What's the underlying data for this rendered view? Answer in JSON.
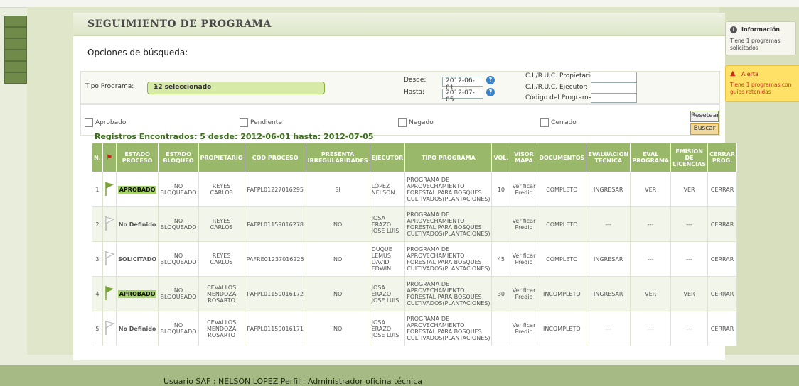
{
  "page": {
    "title": "SEGUIMIENTO DE PROGRAMA",
    "search_options_label": "Opciones de búsqueda:"
  },
  "search": {
    "tipo_programa_label": "Tipo Programa:",
    "tipo_programa_value": "12 seleccionado",
    "desde_label": "Desde:",
    "desde_value": "2012-06-01",
    "hasta_label": "Hasta:",
    "hasta_value": "2012-07-05",
    "ruc_propietario_label": "C.I./R.U.C. Propietario:",
    "ruc_ejecutor_label": "C.I./R.U.C. Ejecutor:",
    "codigo_programa_label": "Código del Programa:",
    "status_filters": [
      "Aprobado",
      "Pendiente",
      "Negado",
      "Cerrado"
    ],
    "reset_label": "Resetear",
    "search_label": "Buscar"
  },
  "results": {
    "summary": "Registros Encontrados: 5 desde: 2012-06-01 hasta: 2012-07-05",
    "columns": [
      "N.",
      "",
      "ESTADO PROCESO",
      "ESTADO BLOQUEO",
      "PROPIETARIO",
      "COD PROCESO",
      "PRESENTA IRREGULARIDADES",
      "EJECUTOR",
      "TIPO PROGRAMA",
      "VOL.",
      "VISOR MAPA",
      "DOCUMENTOS",
      "EVALUACION TECNICA",
      "EVAL PROGRAMA",
      "EMISION DE LICENCIAS",
      "CERRAR PROG."
    ],
    "rows": [
      {
        "n": "1",
        "flag": "green",
        "estado": "APROBADO",
        "bloqueo": "NO BLOQUEADO",
        "propietario": "REYES CARLOS",
        "cod": "PAFPL01227016295",
        "irreg": "SI",
        "ejecutor": "LÓPEZ NELSON",
        "tipo": "PROGRAMA DE APROVECHAMIENTO FORESTAL PARA BOSQUES CULTIVADOS(PLANTACIONES)",
        "vol": "10",
        "visor": "Verificar Predio",
        "docs": "COMPLETO",
        "eval_tec": "INGRESAR",
        "eval_prog": "VER",
        "emision": "VER",
        "cerrar": "CERRAR"
      },
      {
        "n": "2",
        "flag": "white",
        "estado": "No Definido",
        "bloqueo": "NO BLOQUEADO",
        "propietario": "REYES CARLOS",
        "cod": "PAFPL01159016278",
        "irreg": "NO",
        "ejecutor": "JOSA ERAZO JOSE LUIS",
        "tipo": "PROGRAMA DE APROVECHAMIENTO FORESTAL PARA BOSQUES CULTIVADOS(PLANTACIONES)",
        "vol": "",
        "visor": "Verificar Predio",
        "docs": "COMPLETO",
        "eval_tec": "---",
        "eval_prog": "---",
        "emision": "---",
        "cerrar": "CERRAR"
      },
      {
        "n": "3",
        "flag": "white",
        "estado": "SOLICITADO",
        "bloqueo": "NO BLOQUEADO",
        "propietario": "REYES CARLOS",
        "cod": "PAFRE01237016225",
        "irreg": "NO",
        "ejecutor": "DUQUE LEMUS DAVID EDWIN",
        "tipo": "PROGRAMA DE APROVECHAMIENTO FORESTAL PARA BOSQUES CULTIVADOS(PLANTACIONES)",
        "vol": "45",
        "visor": "Verificar Predio",
        "docs": "COMPLETO",
        "eval_tec": "INGRESAR",
        "eval_prog": "---",
        "emision": "---",
        "cerrar": "CERRAR"
      },
      {
        "n": "4",
        "flag": "green",
        "estado": "APROBADO",
        "bloqueo": "NO BLOQUEADO",
        "propietario": "CEVALLOS MENDOZA ROSARTO",
        "cod": "PAFPL01159016172",
        "irreg": "NO",
        "ejecutor": "JOSA ERAZO JOSE LUIS",
        "tipo": "PROGRAMA DE APROVECHAMIENTO FORESTAL PARA BOSQUES CULTIVADOS(PLANTACIONES)",
        "vol": "30",
        "visor": "Verificar Predio",
        "docs": "INCOMPLETO",
        "eval_tec": "INGRESAR",
        "eval_prog": "VER",
        "emision": "VER",
        "cerrar": "CERRAR"
      },
      {
        "n": "5",
        "flag": "white",
        "estado": "No Definido",
        "bloqueo": "NO BLOQUEADO",
        "propietario": "CEVALLOS MENDOZA ROSARTO",
        "cod": "PAFPL01159016171",
        "irreg": "NO",
        "ejecutor": "JOSA ERAZO JOSE LUIS",
        "tipo": "PROGRAMA DE APROVECHAMIENTO FORESTAL PARA BOSQUES CULTIVADOS(PLANTACIONES)",
        "vol": "",
        "visor": "Verificar Predio",
        "docs": "INCOMPLETO",
        "eval_tec": "---",
        "eval_prog": "---",
        "emision": "---",
        "cerrar": "CERRAR"
      }
    ]
  },
  "sidebar": {
    "info_title": "Información",
    "info_text": "Tiene 1 programas solicitados",
    "alert_title": "Alerta",
    "alert_text": "Tiene 1 programas con guías retenidas"
  },
  "footer": {
    "user_text": "Usuario SAF : NELSON LÓPEZ Perfil : Administrador oficina técnica"
  },
  "colors": {
    "accent_green": "#9ab86a",
    "link_green": "#58a020",
    "alert_red": "#e01a1a",
    "alert_yellow": "#ffe167"
  }
}
